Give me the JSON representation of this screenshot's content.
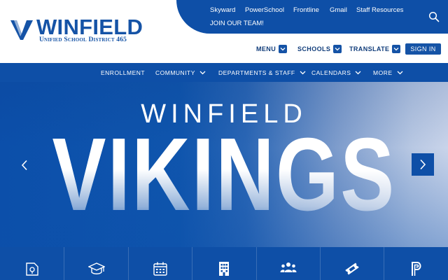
{
  "logo": {
    "name": "WINFIELD",
    "subtitle": "Unified School District 465"
  },
  "utility_links": [
    "Skyward",
    "PowerSchool",
    "Frontline",
    "Gmail",
    "Staff Resources",
    "JOIN OUR TEAM!"
  ],
  "secondary_nav": {
    "menu": "MENU",
    "schools": "SCHOOLS",
    "translate": "TRANSLATE",
    "sign_in": "SIGN IN"
  },
  "main_nav": [
    "ENROLLMENT",
    "COMMUNITY",
    "DEPARTMENTS & STAFF",
    "CALENDARS",
    "MORE"
  ],
  "hero": {
    "line1": "WINFIELD",
    "line2": "VIKINGS"
  },
  "quick_links_icons": [
    "map-pin-document-icon",
    "graduation-cap-icon",
    "calendar-icon",
    "building-icon",
    "people-group-icon",
    "ticket-icon",
    "powerschool-icon"
  ],
  "colors": {
    "brand_blue": "#0e4fa7",
    "logo_blue": "#1553a6",
    "text_navy": "#103c7a",
    "white": "#ffffff"
  }
}
